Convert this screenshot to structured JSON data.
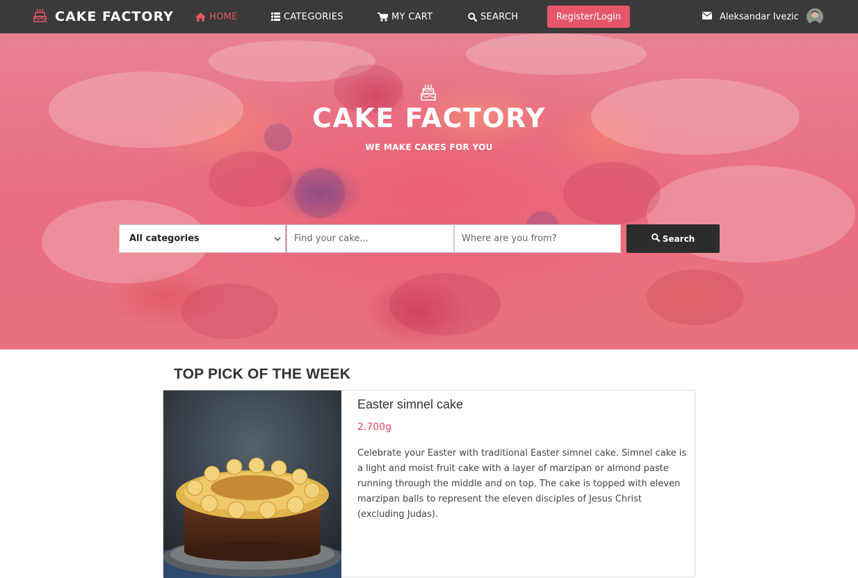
{
  "brand": {
    "name": "CAKE FACTORY",
    "icon": "cake-icon"
  },
  "nav": {
    "home": "HOME",
    "categories": "CATEGORIES",
    "cart": "MY CART",
    "search": "SEARCH",
    "register": "Register/Login",
    "user_name": "Aleksandar Ivezic"
  },
  "hero": {
    "title": "CAKE FACTORY",
    "subtitle": "WE MAKE CAKES FOR YOU",
    "category_selected": "All categories",
    "find_placeholder": "Find your cake...",
    "where_placeholder": "Where are you from?",
    "search_button": "Search"
  },
  "top_pick": {
    "section_title": "TOP PICK OF THE WEEK",
    "name": "Easter simnel cake",
    "weight": "2.700g",
    "description": "Celebrate your Easter with traditional Easter simnel cake. Simnel cake is a light and moist fruit cake with a layer of marzipan or almond paste running through the middle and on top. The cake is topped with eleven marzipan balls to represent the eleven disciples of Jesus Christ (excluding Judas)."
  },
  "colors": {
    "accent": "#e5566a",
    "navbar": "#3a3a3a",
    "search_button": "#2c2c2c"
  }
}
